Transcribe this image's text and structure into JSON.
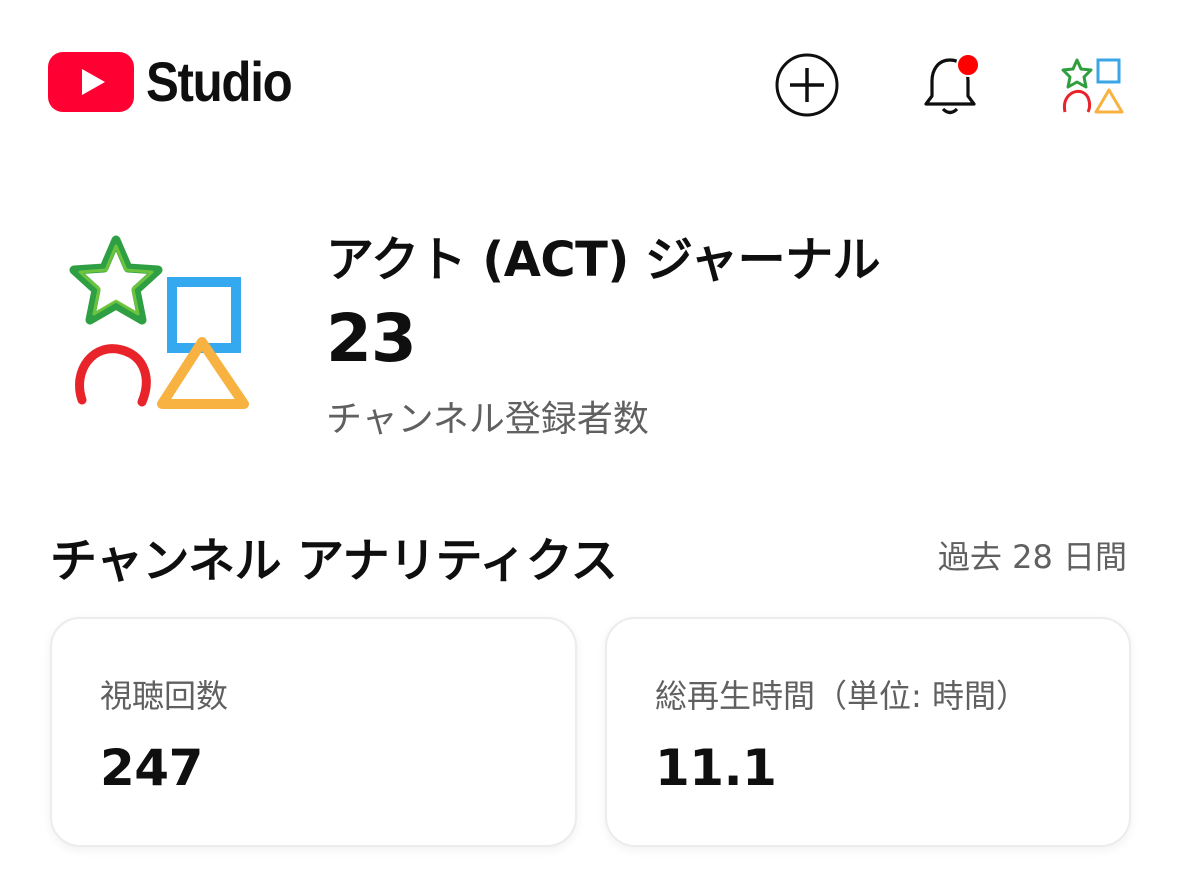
{
  "app": {
    "brand_label": "Studio",
    "brand_color": "#ff0033"
  },
  "header": {
    "create_icon": "plus-circle-icon",
    "notifications_icon": "bell-icon",
    "notification_dot_color": "#ff0000",
    "account_icon": "channel-avatar"
  },
  "channel": {
    "name": "アクト (ACT) ジャーナル",
    "subscriber_count": "23",
    "subscriber_label": "チャンネル登録者数"
  },
  "analytics": {
    "title": "チャンネル アナリティクス",
    "period": "過去 28 日間",
    "cards": [
      {
        "label": "視聴回数",
        "value": "247"
      },
      {
        "label": "総再生時間（単位: 時間）",
        "value": "11.1"
      }
    ]
  }
}
